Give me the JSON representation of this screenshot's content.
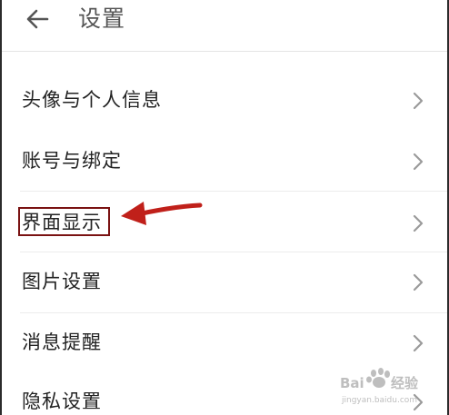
{
  "header": {
    "title": "设置",
    "back_icon": "arrow-left-icon"
  },
  "menu": {
    "items": [
      {
        "label": "头像与个人信息",
        "icon": "chevron-right-icon"
      },
      {
        "label": "账号与绑定",
        "icon": "chevron-right-icon"
      },
      {
        "label": "界面显示",
        "icon": "chevron-right-icon",
        "highlighted": true
      },
      {
        "label": "图片设置",
        "icon": "chevron-right-icon"
      },
      {
        "label": "消息提醒",
        "icon": "chevron-right-icon"
      },
      {
        "label": "隐私设置",
        "icon": "chevron-right-icon"
      }
    ]
  },
  "annotation": {
    "arrow_icon": "red-arrow-icon",
    "highlight_color": "#7a1212",
    "arrow_color": "#c0201a"
  },
  "watermark": {
    "url_text": "jingyan.baidu.com"
  },
  "colors": {
    "text": "#222222",
    "title": "#555555",
    "chevron": "#9a9a9a",
    "divider": "#ececec"
  }
}
